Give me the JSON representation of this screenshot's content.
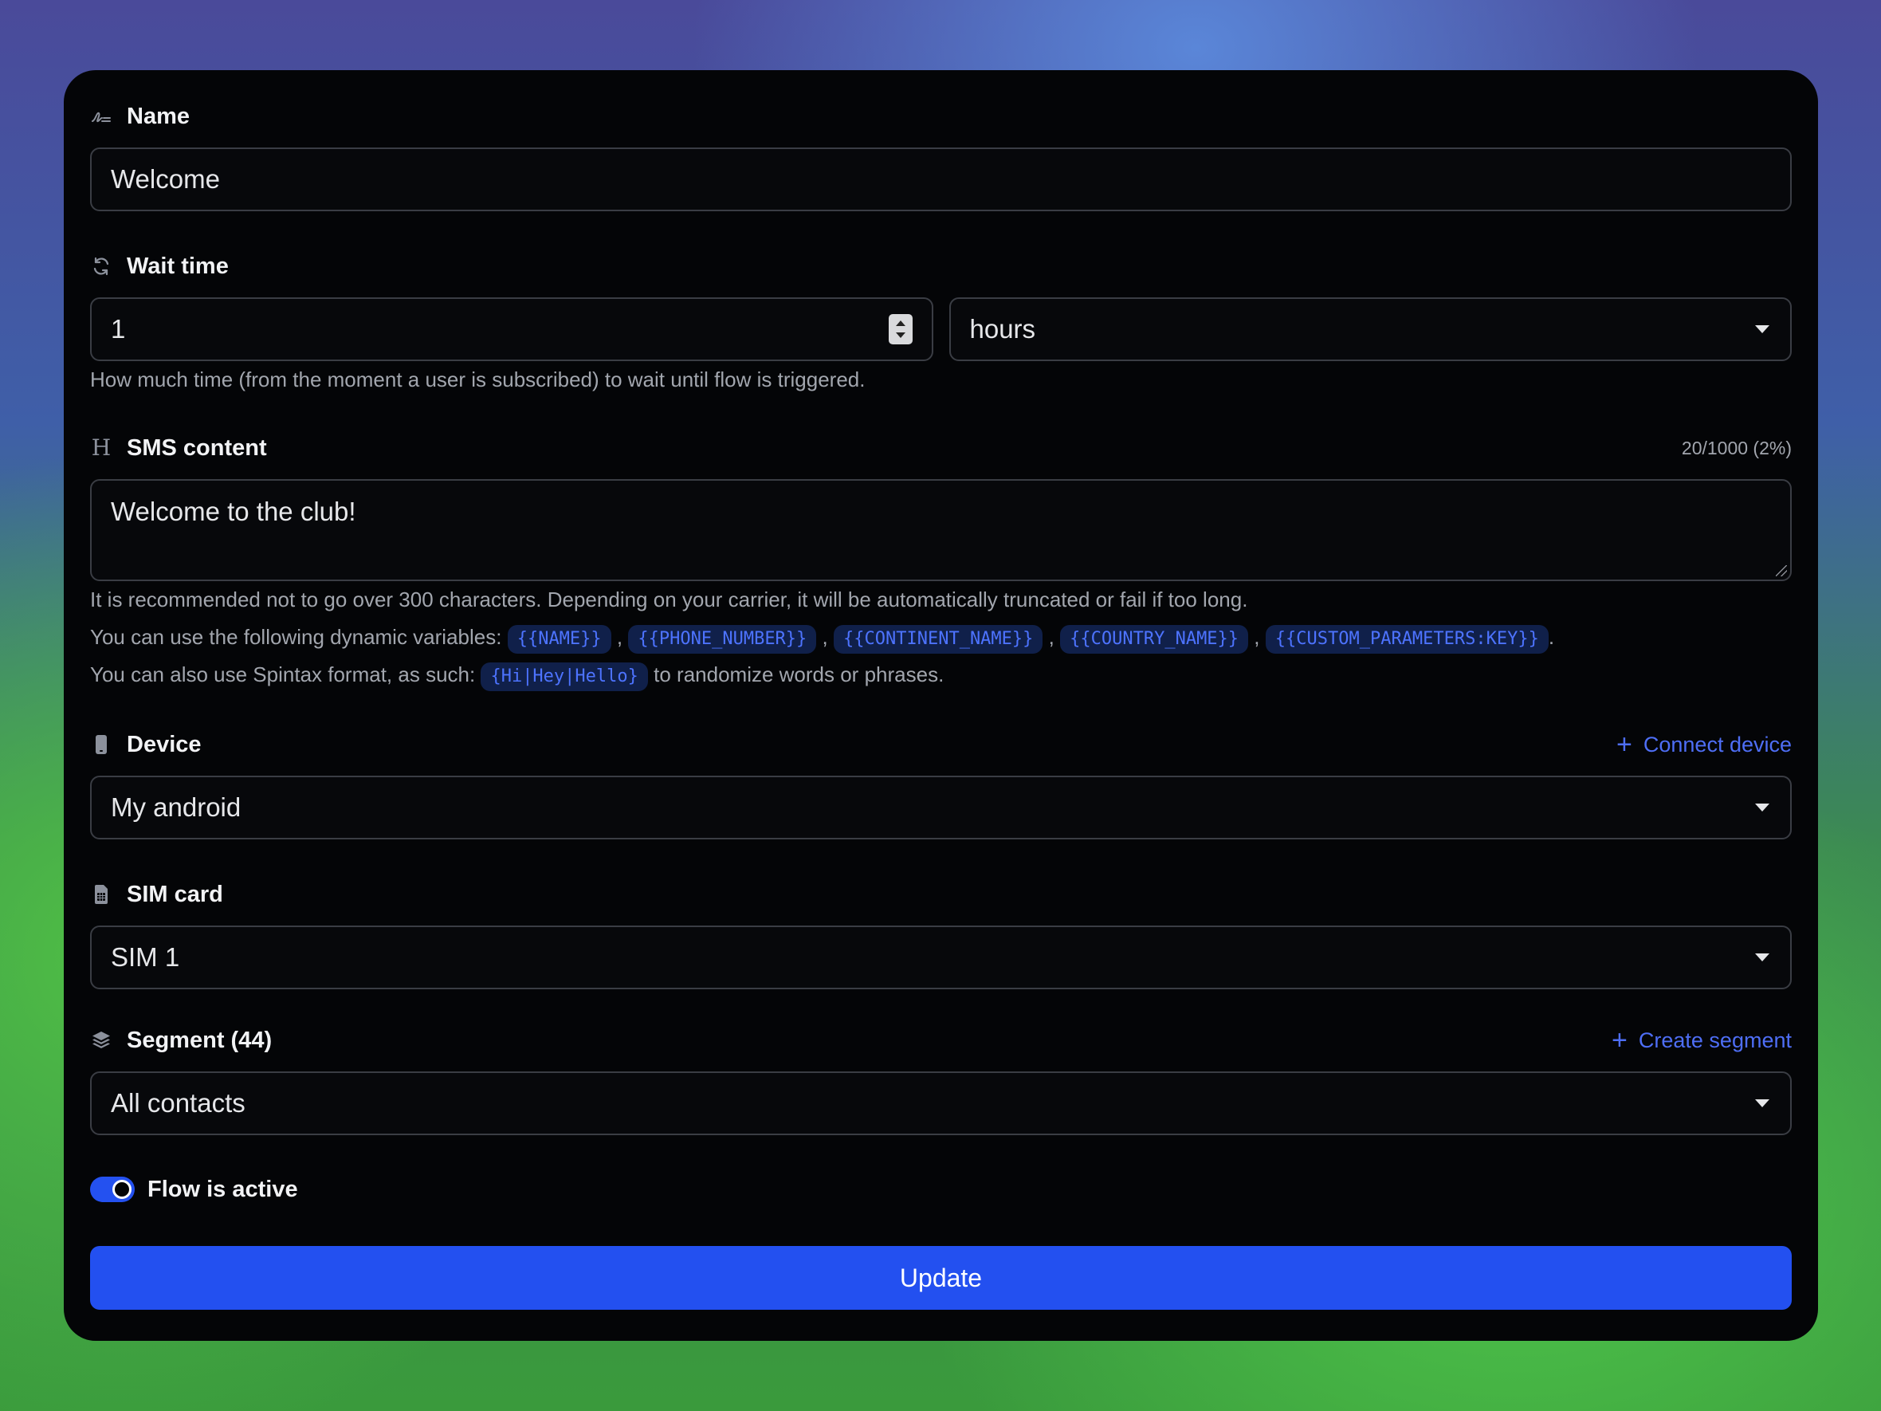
{
  "name": {
    "label": "Name",
    "value": "Welcome"
  },
  "wait_time": {
    "label": "Wait time",
    "value": "1",
    "unit": "hours",
    "help": "How much time (from the moment a user is subscribed) to wait until flow is triggered."
  },
  "sms": {
    "label": "SMS content",
    "counter": "20/1000 (2%)",
    "value": "Welcome to the club!",
    "help_length": "It is recommended not to go over 300 characters. Depending on your carrier, it will be automatically truncated or fail if too long.",
    "help_vars_prefix": "You can use the following dynamic variables:",
    "variables": [
      "{{NAME}}",
      "{{PHONE_NUMBER}}",
      "{{CONTINENT_NAME}}",
      "{{COUNTRY_NAME}}",
      "{{CUSTOM_PARAMETERS:KEY}}"
    ],
    "separator": ",",
    "end_period": ".",
    "help_spintax_prefix": "You can also use Spintax format, as such:",
    "spintax_example": "{Hi|Hey|Hello}",
    "help_spintax_suffix": "to randomize words or phrases."
  },
  "device": {
    "label": "Device",
    "link": "Connect device",
    "value": "My android"
  },
  "sim": {
    "label": "SIM card",
    "value": "SIM 1"
  },
  "segment": {
    "label": "Segment (44)",
    "link": "Create segment",
    "value": "All contacts"
  },
  "flow": {
    "label": "Flow is active",
    "active": true
  },
  "submit": {
    "label": "Update"
  },
  "colors": {
    "accent": "#2350f0",
    "link": "#4e6ef5",
    "card_bg": "#040507"
  }
}
